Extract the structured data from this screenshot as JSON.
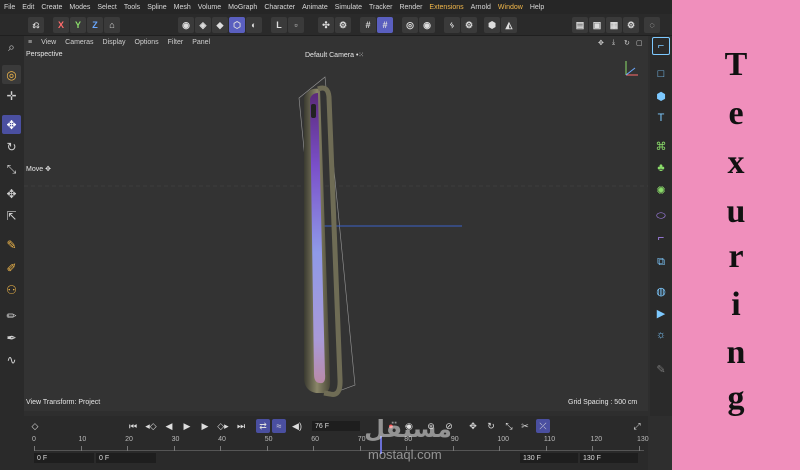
{
  "menu": [
    "File",
    "Edit",
    "Create",
    "Modes",
    "Select",
    "Tools",
    "Spline",
    "Mesh",
    "Volume",
    "MoGraph",
    "Character",
    "Animate",
    "Simulate",
    "Tracker",
    "Render",
    "Extensions",
    "Arnold",
    "Window",
    "Help"
  ],
  "toolbar": {
    "x": "X",
    "y": "Y",
    "z": "Z"
  },
  "viewport_menu": [
    "View",
    "Cameras",
    "Display",
    "Options",
    "Filter",
    "Panel"
  ],
  "viewport": {
    "name": "Perspective",
    "camera": "Default Camera",
    "camera_suffix": "•⁙",
    "move_label": "Move",
    "view_transform": "View Transform: Project",
    "grid_spacing": "Grid Spacing : 500 cm"
  },
  "timeline": {
    "current_frame": "76 F",
    "start_left": "0 F",
    "start_right": "0 F",
    "end_left": "130 F",
    "end_right": "130 F",
    "ticks": [
      "0",
      "10",
      "20",
      "30",
      "40",
      "50",
      "60",
      "70",
      "80",
      "90",
      "100",
      "110",
      "120",
      "130"
    ]
  },
  "watermark": {
    "url": "mostaql.com",
    "arabic": "مستقل"
  },
  "side_title_letters": [
    "T",
    "e",
    "x",
    "u",
    "r",
    "i",
    "n",
    "g"
  ],
  "colors": {
    "accent": "#5a5fbf",
    "panel_bg": "#f08fbc",
    "menu_highlight": "#f2b84b",
    "icon_blue": "#7dc9ff"
  }
}
